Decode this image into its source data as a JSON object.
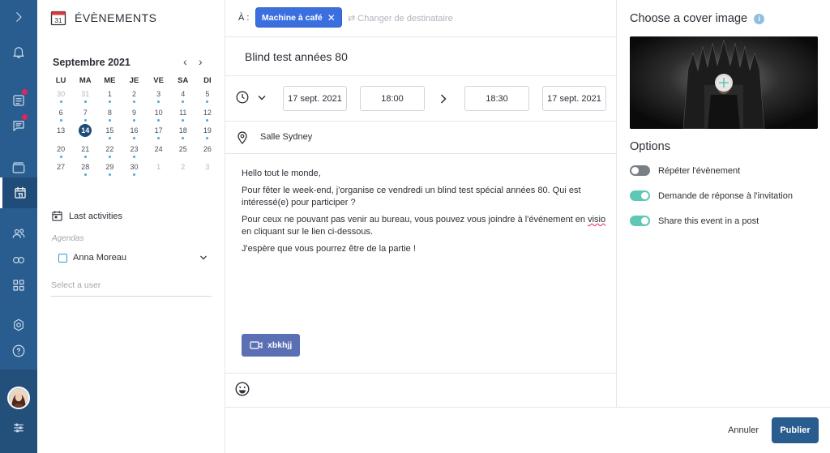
{
  "app": {
    "title": "ÉVÈNEMENTS",
    "calendar_icon_day": "31"
  },
  "calendar": {
    "month": "Septembre 2021",
    "weekdays": [
      "LU",
      "MA",
      "ME",
      "JE",
      "VE",
      "SA",
      "DI"
    ],
    "weeks": [
      [
        {
          "d": "30",
          "m": true,
          "e": true
        },
        {
          "d": "31",
          "m": true,
          "e": true
        },
        {
          "d": "1",
          "e": true
        },
        {
          "d": "2",
          "e": true
        },
        {
          "d": "3",
          "e": true
        },
        {
          "d": "4",
          "e": true
        },
        {
          "d": "5",
          "e": true
        }
      ],
      [
        {
          "d": "6",
          "e": true
        },
        {
          "d": "7",
          "e": true
        },
        {
          "d": "8",
          "e": true
        },
        {
          "d": "9",
          "e": true
        },
        {
          "d": "10",
          "e": true
        },
        {
          "d": "11",
          "e": true
        },
        {
          "d": "12",
          "e": true
        }
      ],
      [
        {
          "d": "13"
        },
        {
          "d": "14",
          "today": true
        },
        {
          "d": "15",
          "e": true
        },
        {
          "d": "16",
          "e": true
        },
        {
          "d": "17",
          "e": true
        },
        {
          "d": "18",
          "e": true
        },
        {
          "d": "19",
          "e": true
        }
      ],
      [
        {
          "d": "20",
          "e": true
        },
        {
          "d": "21",
          "e": true
        },
        {
          "d": "22",
          "e": true
        },
        {
          "d": "23",
          "e": true
        },
        {
          "d": "24"
        },
        {
          "d": "25"
        },
        {
          "d": "26"
        }
      ],
      [
        {
          "d": "27"
        },
        {
          "d": "28",
          "e": true
        },
        {
          "d": "29",
          "e": true
        },
        {
          "d": "30",
          "e": true
        },
        {
          "d": "1",
          "m": true
        },
        {
          "d": "2",
          "m": true
        },
        {
          "d": "3",
          "m": true
        }
      ]
    ],
    "last_activities": "Last activities",
    "agendas_label": "Agendas",
    "agenda_user": "Anna Moreau",
    "select_user_placeholder": "Select a user"
  },
  "recipient": {
    "label": "À :",
    "chip": "Machine à café",
    "change": "Changer de destinataire"
  },
  "event": {
    "title": "Blind test années 80",
    "start_date": "17 sept. 2021",
    "start_time": "18:00",
    "end_time": "18:30",
    "end_date": "17 sept. 2021",
    "location": "Salle Sydney",
    "body": {
      "p1": "Hello tout le monde,",
      "p2": "Pour fêter le week-end, j'organise ce vendredi un blind test spécial années 80. Qui est intéressé(e) pour participer ?",
      "p3_a": "Pour ceux ne pouvant pas venir au bureau, vous pouvez vous joindre à l'événement en ",
      "p3_visio": "visio",
      "p3_b": " en cliquant sur le lien ci-dessous.",
      "p4": "J'espère que vous pourrez être de la partie !"
    },
    "visio_button": "xbkhjj"
  },
  "right_panel": {
    "cover_title": "Choose a cover image",
    "info_glyph": "i",
    "options_title": "Options",
    "options": [
      {
        "label": "Répéter l'évènement",
        "on": false
      },
      {
        "label": "Demande de réponse à l'invitation",
        "on": true
      },
      {
        "label": "Share this event in a post",
        "on": true
      }
    ]
  },
  "footer": {
    "cancel": "Annuler",
    "publish": "Publier"
  },
  "colors": {
    "rail": "#2a5d8f",
    "accent": "#3b6fe0",
    "toggle_on": "#5fc7b6",
    "notification": "#e0245e",
    "today": "#1e4b78"
  }
}
